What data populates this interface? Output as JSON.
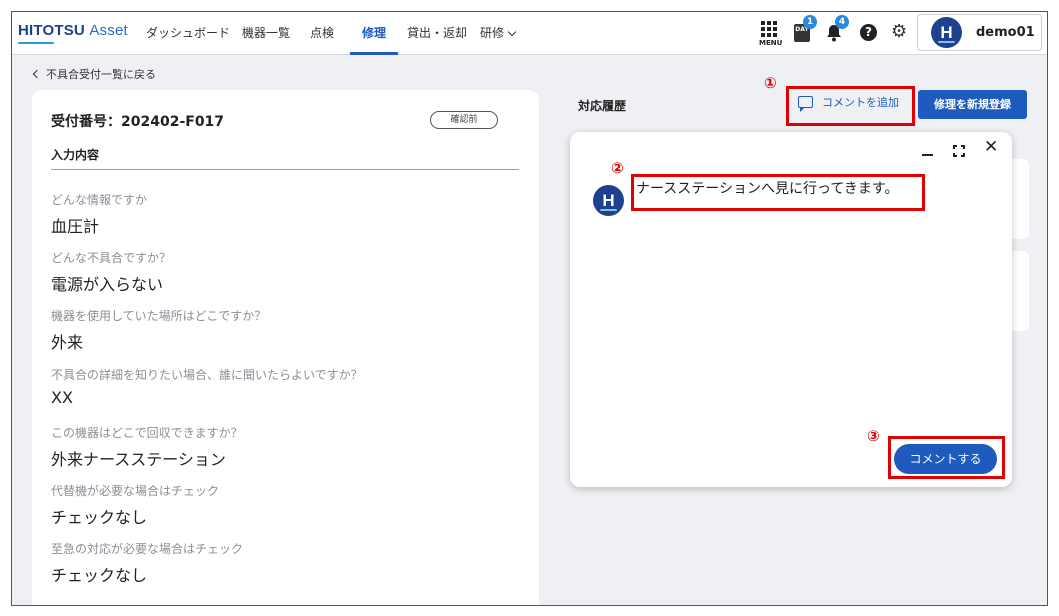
{
  "header": {
    "logo_main": "HITOTSU",
    "logo_sub": "Asset",
    "nav": [
      {
        "label": "ダッシュボード"
      },
      {
        "label": "機器一覧"
      },
      {
        "label": "点検"
      },
      {
        "label": "修理"
      },
      {
        "label": "貸出・返却"
      },
      {
        "label": "研修"
      }
    ],
    "active_nav": "修理",
    "menu_label": "MENU",
    "day_badge_text": "DAY",
    "day_badge_count": "1",
    "bell_badge_count": "4",
    "user_initial": "H",
    "username": "demo01"
  },
  "back_link": "不具合受付一覧に戻る",
  "receipt": {
    "label": "受付番号：202402-F017",
    "status": "確認前",
    "section_title": "入力内容",
    "items": [
      {
        "q": "どんな情報ですか",
        "a": "血圧計"
      },
      {
        "q": "どんな不具合ですか？",
        "a": "電源が入らない"
      },
      {
        "q": "機器を使用していた場所はどこですか？",
        "a": "外来"
      },
      {
        "q": "不具合の詳細を知りたい場合、誰に聞いたらよいですか？",
        "a": "XX"
      },
      {
        "q": "この機器はどこで回収できますか？",
        "a": "外来ナースステーション"
      },
      {
        "q": "代替機が必要な場合はチェック",
        "a": "チェックなし"
      },
      {
        "q": "至急の対応が必要な場合はチェック",
        "a": "チェックなし"
      }
    ]
  },
  "history": {
    "title": "対応履歴",
    "add_comment_label": "コメントを追加",
    "new_repair_label": "修理を新規登録"
  },
  "dialog": {
    "avatar_initial": "H",
    "message": "ナースステーションへ見に行ってきます。",
    "submit_label": "コメントする"
  },
  "annotations": [
    "①",
    "②",
    "③"
  ],
  "colors": {
    "brand": "#1f5bbf",
    "annotation": "#e00000",
    "badge": "#2a88dd"
  }
}
